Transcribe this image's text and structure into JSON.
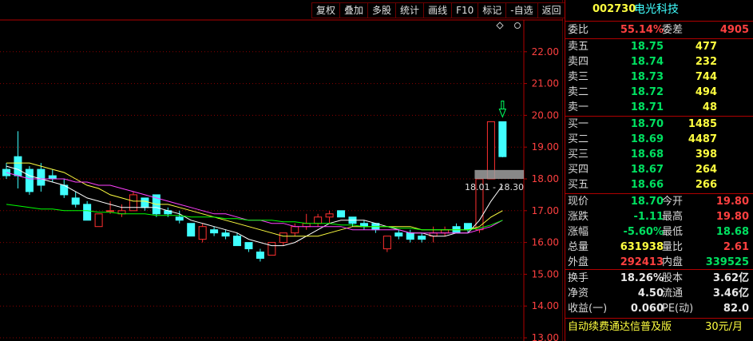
{
  "toolbar": {
    "buttons": [
      "复权",
      "叠加",
      "多股",
      "统计",
      "画线",
      "F10",
      "标记",
      "-自选",
      "返回"
    ]
  },
  "stock": {
    "code": "002730",
    "name": "电光科技"
  },
  "commission": {
    "ratio_label": "委比",
    "ratio_value": "55.14%",
    "diff_label": "委差",
    "diff_value": "4905"
  },
  "sell_orders": [
    {
      "label": "卖五",
      "price": "18.75",
      "volume": "477"
    },
    {
      "label": "卖四",
      "price": "18.74",
      "volume": "232"
    },
    {
      "label": "卖三",
      "price": "18.73",
      "volume": "744"
    },
    {
      "label": "卖二",
      "price": "18.72",
      "volume": "494"
    },
    {
      "label": "卖一",
      "price": "18.71",
      "volume": "48"
    }
  ],
  "buy_orders": [
    {
      "label": "买一",
      "price": "18.70",
      "volume": "1485"
    },
    {
      "label": "买二",
      "price": "18.69",
      "volume": "4487"
    },
    {
      "label": "买三",
      "price": "18.68",
      "volume": "398"
    },
    {
      "label": "买四",
      "price": "18.67",
      "volume": "264"
    },
    {
      "label": "买五",
      "price": "18.66",
      "volume": "266"
    }
  ],
  "quote": [
    {
      "l1": "现价",
      "v1": "18.70",
      "l2": "今开",
      "v2": "19.80"
    },
    {
      "l1": "涨跌",
      "v1": "-1.11",
      "l2": "最高",
      "v2": "19.80"
    },
    {
      "l1": "涨幅",
      "v1": "-5.60%",
      "l2": "最低",
      "v2": "18.68"
    },
    {
      "l1": "总量",
      "v1": "631938",
      "l2": "量比",
      "v2": "2.61"
    },
    {
      "l1": "外盘",
      "v1": "292413",
      "l2": "内盘",
      "v2": "339525"
    }
  ],
  "fundamentals": [
    {
      "l1": "换手",
      "v1": "18.26%",
      "l2": "股本",
      "v2": "3.62亿"
    },
    {
      "l1": "净资",
      "v1": "4.50",
      "l2": "流通",
      "v2": "3.46亿"
    },
    {
      "l1": "收益(一)",
      "v1": "0.060",
      "l2": "PE(动)",
      "v2": "82.0"
    }
  ],
  "ad_banner": {
    "text": "自动续费通达信普及版",
    "price": "30元/月"
  },
  "overlay_label": "18.01 - 18.30",
  "colors": {
    "up": "#ff3030",
    "down": "#40ffff",
    "ma5": "#ffffff",
    "ma10": "#ffff40",
    "ma20": "#ff40ff",
    "ma60": "#00ff00",
    "grid": "#8a0000"
  },
  "chart_data": {
    "type": "candlestick",
    "ylim": [
      12.9,
      23.0
    ],
    "yticks": [
      "22.00",
      "21.00",
      "20.00",
      "19.00",
      "18.00",
      "17.00",
      "16.00",
      "15.00",
      "14.00",
      "13.00"
    ],
    "candles": [
      {
        "o": 18.3,
        "h": 18.5,
        "l": 18.0,
        "c": 18.1
      },
      {
        "o": 18.7,
        "h": 19.5,
        "l": 17.7,
        "c": 18.1
      },
      {
        "o": 18.3,
        "h": 18.4,
        "l": 17.5,
        "c": 17.6
      },
      {
        "o": 18.3,
        "h": 18.5,
        "l": 17.6,
        "c": 17.8
      },
      {
        "o": 18.1,
        "h": 18.3,
        "l": 17.9,
        "c": 18.0
      },
      {
        "o": 17.8,
        "h": 18.0,
        "l": 17.4,
        "c": 17.5
      },
      {
        "o": 17.4,
        "h": 17.6,
        "l": 17.1,
        "c": 17.2
      },
      {
        "o": 17.2,
        "h": 17.3,
        "l": 16.7,
        "c": 16.7
      },
      {
        "o": 16.5,
        "h": 16.9,
        "l": 16.5,
        "c": 16.9
      },
      {
        "o": 17.0,
        "h": 17.3,
        "l": 16.9,
        "c": 17.0
      },
      {
        "o": 16.9,
        "h": 17.2,
        "l": 16.8,
        "c": 17.0
      },
      {
        "o": 17.0,
        "h": 17.6,
        "l": 17.0,
        "c": 17.5
      },
      {
        "o": 17.4,
        "h": 17.4,
        "l": 17.0,
        "c": 17.1
      },
      {
        "o": 17.5,
        "h": 17.5,
        "l": 16.8,
        "c": 16.9
      },
      {
        "o": 17.0,
        "h": 17.1,
        "l": 16.8,
        "c": 16.9
      },
      {
        "o": 16.8,
        "h": 17.0,
        "l": 16.6,
        "c": 16.7
      },
      {
        "o": 16.6,
        "h": 16.6,
        "l": 16.2,
        "c": 16.2
      },
      {
        "o": 16.1,
        "h": 16.6,
        "l": 16.0,
        "c": 16.5
      },
      {
        "o": 16.4,
        "h": 16.5,
        "l": 16.2,
        "c": 16.3
      },
      {
        "o": 16.3,
        "h": 16.4,
        "l": 16.1,
        "c": 16.2
      },
      {
        "o": 16.2,
        "h": 16.3,
        "l": 15.9,
        "c": 15.9
      },
      {
        "o": 16.0,
        "h": 16.0,
        "l": 15.7,
        "c": 15.8
      },
      {
        "o": 15.7,
        "h": 15.8,
        "l": 15.4,
        "c": 15.5
      },
      {
        "o": 15.6,
        "h": 16.0,
        "l": 15.6,
        "c": 16.0
      },
      {
        "o": 16.0,
        "h": 16.3,
        "l": 15.9,
        "c": 16.3
      },
      {
        "o": 16.3,
        "h": 16.6,
        "l": 16.2,
        "c": 16.5
      },
      {
        "o": 16.5,
        "h": 16.9,
        "l": 16.4,
        "c": 16.6
      },
      {
        "o": 16.6,
        "h": 16.9,
        "l": 16.5,
        "c": 16.8
      },
      {
        "o": 16.8,
        "h": 17.0,
        "l": 16.6,
        "c": 16.9
      },
      {
        "o": 17.0,
        "h": 17.0,
        "l": 16.8,
        "c": 16.8
      },
      {
        "o": 16.8,
        "h": 16.8,
        "l": 16.5,
        "c": 16.6
      },
      {
        "o": 16.6,
        "h": 16.7,
        "l": 16.4,
        "c": 16.5
      },
      {
        "o": 16.6,
        "h": 16.6,
        "l": 16.3,
        "c": 16.4
      },
      {
        "o": 15.8,
        "h": 16.2,
        "l": 15.7,
        "c": 16.2
      },
      {
        "o": 16.3,
        "h": 16.4,
        "l": 16.1,
        "c": 16.2
      },
      {
        "o": 16.3,
        "h": 16.4,
        "l": 16.0,
        "c": 16.1
      },
      {
        "o": 16.2,
        "h": 16.3,
        "l": 16.0,
        "c": 16.1
      },
      {
        "o": 16.2,
        "h": 16.5,
        "l": 16.0,
        "c": 16.3
      },
      {
        "o": 16.3,
        "h": 16.5,
        "l": 16.2,
        "c": 16.4
      },
      {
        "o": 16.5,
        "h": 16.6,
        "l": 16.3,
        "c": 16.3
      },
      {
        "o": 16.6,
        "h": 16.6,
        "l": 16.3,
        "c": 16.4
      },
      {
        "o": 16.4,
        "h": 18.0,
        "l": 16.3,
        "c": 18.0
      },
      {
        "o": 18.0,
        "h": 19.8,
        "l": 18.0,
        "c": 19.8
      },
      {
        "o": 19.8,
        "h": 19.8,
        "l": 18.68,
        "c": 18.7
      }
    ],
    "ma": [
      {
        "name": "ma5",
        "color": "#ffffff",
        "values": [
          18.4,
          18.3,
          18.1,
          18.0,
          17.9,
          17.8,
          17.6,
          17.4,
          17.3,
          17.2,
          17.1,
          17.1,
          17.1,
          17.1,
          17.0,
          16.9,
          16.7,
          16.6,
          16.5,
          16.4,
          16.3,
          16.1,
          16.0,
          15.9,
          15.9,
          16.0,
          16.2,
          16.4,
          16.6,
          16.7,
          16.7,
          16.7,
          16.6,
          16.5,
          16.4,
          16.3,
          16.3,
          16.2,
          16.2,
          16.3,
          16.3,
          16.7,
          17.3,
          17.8
        ]
      },
      {
        "name": "ma10",
        "color": "#ffff40",
        "values": [
          18.5,
          18.5,
          18.5,
          18.4,
          18.3,
          18.2,
          18.0,
          17.8,
          17.7,
          17.5,
          17.4,
          17.3,
          17.3,
          17.2,
          17.2,
          17.1,
          17.0,
          16.9,
          16.8,
          16.7,
          16.6,
          16.5,
          16.4,
          16.3,
          16.2,
          16.2,
          16.2,
          16.2,
          16.3,
          16.4,
          16.5,
          16.5,
          16.5,
          16.5,
          16.5,
          16.5,
          16.4,
          16.4,
          16.4,
          16.4,
          16.4,
          16.5,
          16.8,
          17.0
        ]
      },
      {
        "name": "ma20",
        "color": "#ff40ff",
        "values": [
          18.2,
          18.1,
          18.0,
          18.0,
          18.0,
          18.0,
          17.9,
          17.9,
          17.8,
          17.8,
          17.7,
          17.6,
          17.5,
          17.4,
          17.3,
          17.2,
          17.1,
          17.0,
          16.9,
          16.9,
          16.8,
          16.7,
          16.7,
          16.6,
          16.6,
          16.5,
          16.5,
          16.5,
          16.5,
          16.5,
          16.4,
          16.4,
          16.4,
          16.4,
          16.4,
          16.3,
          16.3,
          16.3,
          16.3,
          16.3,
          16.3,
          16.4,
          16.5,
          16.7
        ]
      },
      {
        "name": "ma60",
        "color": "#00ff00",
        "values": [
          17.2,
          17.15,
          17.1,
          17.05,
          17.05,
          17.0,
          17.0,
          17.0,
          16.95,
          16.95,
          16.9,
          16.9,
          16.9,
          16.85,
          16.85,
          16.85,
          16.8,
          16.8,
          16.8,
          16.75,
          16.75,
          16.7,
          16.7,
          16.7,
          16.65,
          16.65,
          16.6,
          16.6,
          16.6,
          16.55,
          16.55,
          16.5,
          16.5,
          16.5,
          16.45,
          16.45,
          16.4,
          16.4,
          16.4,
          16.4,
          16.4,
          16.45,
          16.55,
          16.7
        ]
      }
    ]
  }
}
